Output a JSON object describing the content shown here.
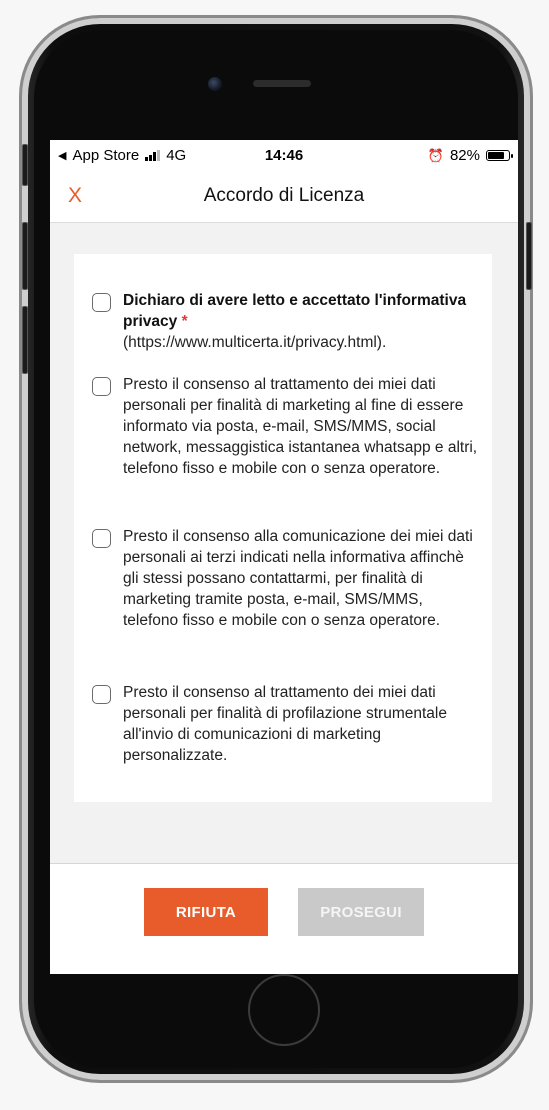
{
  "status_bar": {
    "back_app": "App Store",
    "network": "4G",
    "time": "14:46",
    "battery_percent": "82%",
    "battery_level": 0.82
  },
  "nav": {
    "close_label": "X",
    "title": "Accordo di Licenza"
  },
  "consents": [
    {
      "bold_text": "Dichiaro di avere letto e accettato l'informativa privacy",
      "required_mark": "*",
      "text": "(https://www.multicerta.it/privacy.html).",
      "checked": false
    },
    {
      "text": "Presto il consenso al trattamento dei miei dati personali per finalità di marketing al fine di essere informato via posta, e-mail, SMS/MMS, social network, messaggistica istantanea whatsapp e altri, telefono fisso e mobile con o senza operatore.",
      "checked": false
    },
    {
      "text": "Presto il consenso alla comunicazione dei miei dati personali ai terzi indicati nella informativa affinchè gli stessi possano contattarmi, per finalità di marketing tramite posta, e-mail, SMS/MMS, telefono fisso e mobile con o senza operatore.",
      "checked": false
    },
    {
      "text": "Presto il consenso al trattamento dei miei dati personali per finalità di profilazione strumentale all'invio di comunicazioni di marketing personalizzate.",
      "checked": false
    }
  ],
  "footer": {
    "reject_label": "RIFIUTA",
    "continue_label": "PROSEGUI"
  },
  "colors": {
    "accent": "#e85c2b",
    "disabled": "#c9c9c9"
  }
}
